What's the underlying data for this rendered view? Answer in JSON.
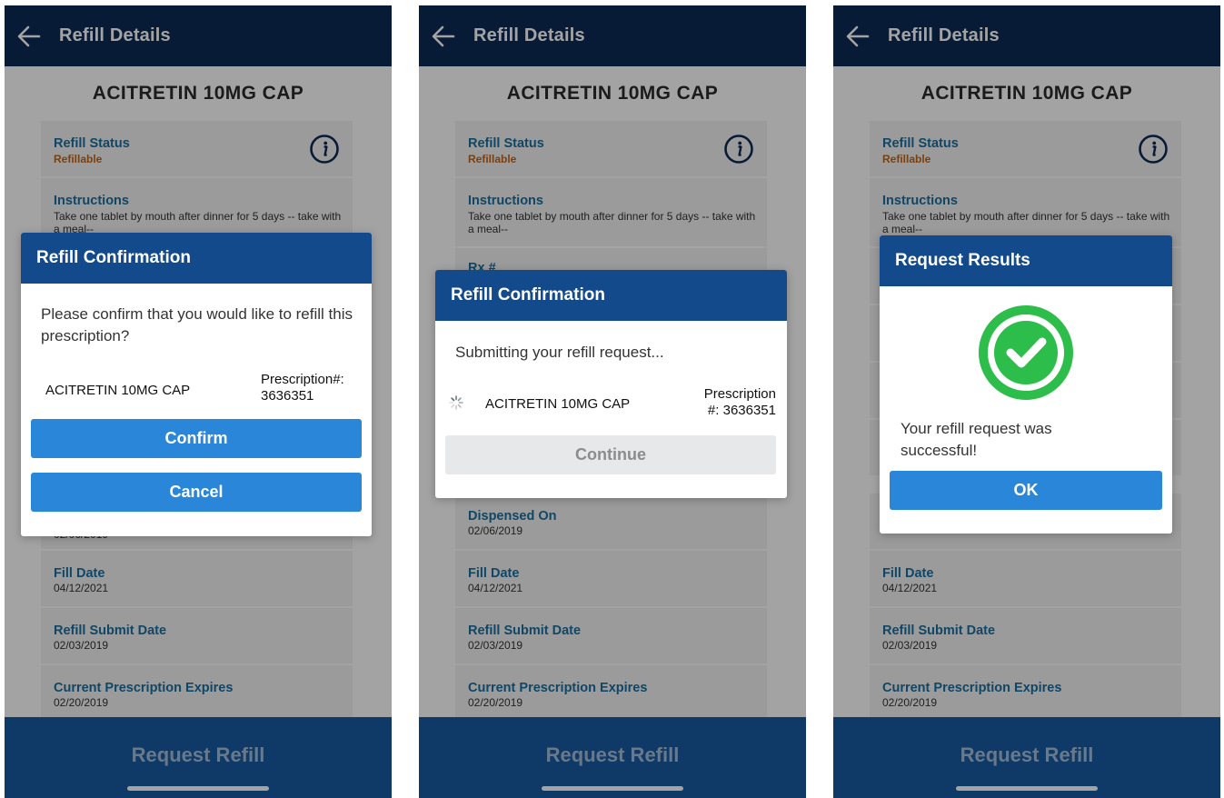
{
  "app": {
    "header_title": "Refill Details",
    "drug_name": "ACITRETIN 10MG CAP",
    "bottom_button": "Request Refill"
  },
  "details": {
    "refill_status_label": "Refill Status",
    "refill_status_value": "Refillable",
    "instructions_label": "Instructions",
    "instructions_value": "Take one tablet by mouth after dinner for 5 days -- take with a meal--",
    "rx_label_partial": "Rx #",
    "dispensed_on_label": "Dispensed On",
    "dispensed_on_value": "02/06/2019",
    "dispensed_on_value_partial": "02/06/2019",
    "fill_date_label": "Fill Date",
    "fill_date_value": "04/12/2021",
    "refill_submit_label": "Refill Submit Date",
    "refill_submit_value": "02/03/2019",
    "expires_label": "Current Prescription Expires",
    "expires_value": "02/20/2019"
  },
  "dialog_confirm": {
    "title": "Refill Confirmation",
    "message": "Please confirm that you would like to refill this prescription?",
    "drug": "ACITRETIN 10MG CAP",
    "rx_line1": "Prescription#:",
    "rx_line2": "3636351",
    "confirm_label": "Confirm",
    "cancel_label": "Cancel"
  },
  "dialog_submitting": {
    "title": "Refill Confirmation",
    "message": "Submitting your refill request...",
    "drug": "ACITRETIN 10MG CAP",
    "rx_line1": "Prescription",
    "rx_line2": "#: 3636351",
    "continue_label": "Continue"
  },
  "dialog_results": {
    "title": "Request Results",
    "message": "Your refill request was successful!",
    "ok_label": "OK"
  },
  "colors": {
    "header": "#0d2b55",
    "dialog_header": "#124a8c",
    "button": "#2a86d8",
    "bottom_bar": "#185aa0",
    "label": "#1a6fa0",
    "status": "#c0641c",
    "success": "#2dbd4a"
  }
}
